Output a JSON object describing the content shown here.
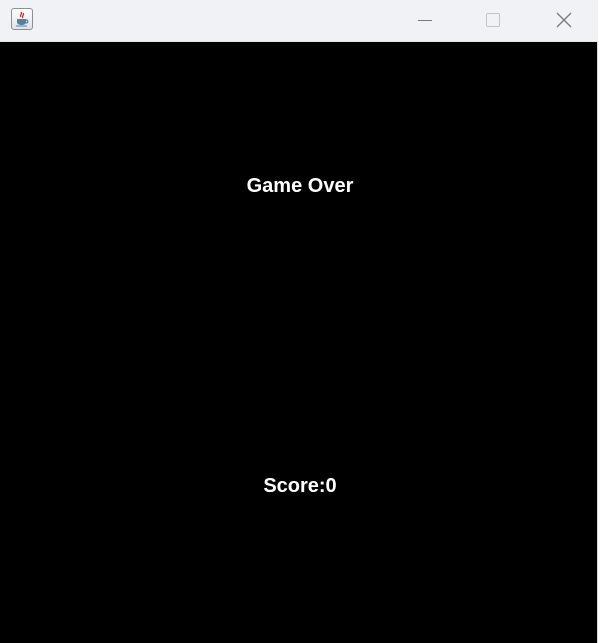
{
  "window": {
    "title_icon": "java-coffee-cup-icon",
    "controls": {
      "minimize_icon": "minimize-icon",
      "maximize_icon": "maximize-icon",
      "close_icon": "close-icon"
    }
  },
  "game": {
    "background_color": "#000000",
    "text_color": "#ffffff",
    "game_over_text": "Game Over",
    "score_text": "Score:0"
  }
}
